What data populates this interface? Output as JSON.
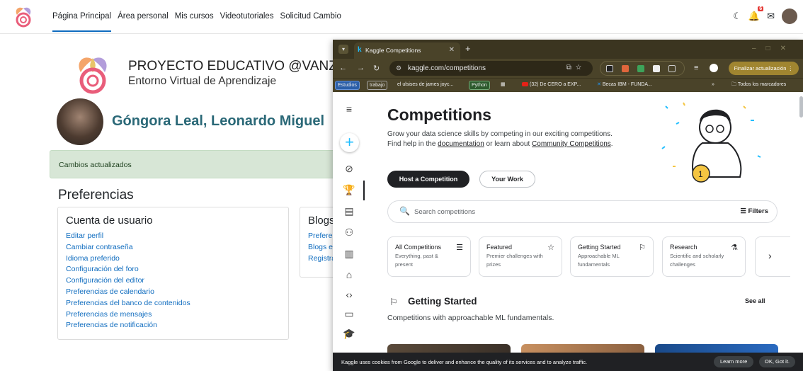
{
  "moodle": {
    "nav": [
      "Página Principal",
      "Área personal",
      "Mis cursos",
      "Videotutoriales",
      "Solicitud Cambio"
    ],
    "notification_count": "6",
    "brand_title": "PROYECTO EDUCATIVO @VANZA",
    "brand_subtitle": "Entorno Virtual de Aprendizaje",
    "user_name": "Góngora Leal, Leonardo Miguel",
    "alert": "Cambios actualizados",
    "preferences_title": "Preferencias",
    "account_card": {
      "title": "Cuenta de usuario",
      "links": [
        "Editar perfil",
        "Cambiar contraseña",
        "Idioma preferido",
        "Configuración del foro",
        "Configuración del editor",
        "Preferencias de calendario",
        "Preferencias del banco de contenidos",
        "Preferencias de mensajes",
        "Preferencias de notificación"
      ]
    },
    "blogs_card": {
      "title": "Blogs",
      "links": [
        "Prefere",
        "Blogs e",
        "Registra"
      ]
    }
  },
  "browser": {
    "tab_title": "Kaggle Competitions",
    "url": "kaggle.com/competitions",
    "update_button": "Finalizar actualización",
    "bookmarks": [
      "Estudios",
      "trabajo",
      "el ulsises de james joyc...",
      "Python",
      "(32) De CERO a EXP...",
      "Becas IBM - FUNDA...",
      "Todos los marcadores"
    ]
  },
  "kaggle": {
    "title": "Competitions",
    "desc_1": "Grow your data science skills by competing in our exciting competitions. Find help in the ",
    "desc_link1": "documentation",
    "desc_2": " or learn about ",
    "desc_link2": "Community Competitions",
    "desc_3": ".",
    "host_button": "Host a Competition",
    "work_button": "Your Work",
    "search_placeholder": "Search competitions",
    "filters": "Filters",
    "categories": [
      {
        "title": "All Competitions",
        "desc": "Everything, past & present",
        "icon": "list-icon"
      },
      {
        "title": "Featured",
        "desc": "Premier challenges with prizes",
        "icon": "star-icon"
      },
      {
        "title": "Getting Started",
        "desc": "Approachable ML fundamentals",
        "icon": "flag-icon"
      },
      {
        "title": "Research",
        "desc": "Scientific and scholarly challenges",
        "icon": "flask-icon"
      }
    ],
    "section_title": "Getting Started",
    "section_desc": "Competitions with approachable ML fundamentals.",
    "see_all": "See all",
    "cookie_msg": "Kaggle uses cookies from Google to deliver and enhance the quality of its services and to analyze traffic.",
    "learn_more": "Learn more",
    "ok_got_it": "OK, Got it."
  }
}
